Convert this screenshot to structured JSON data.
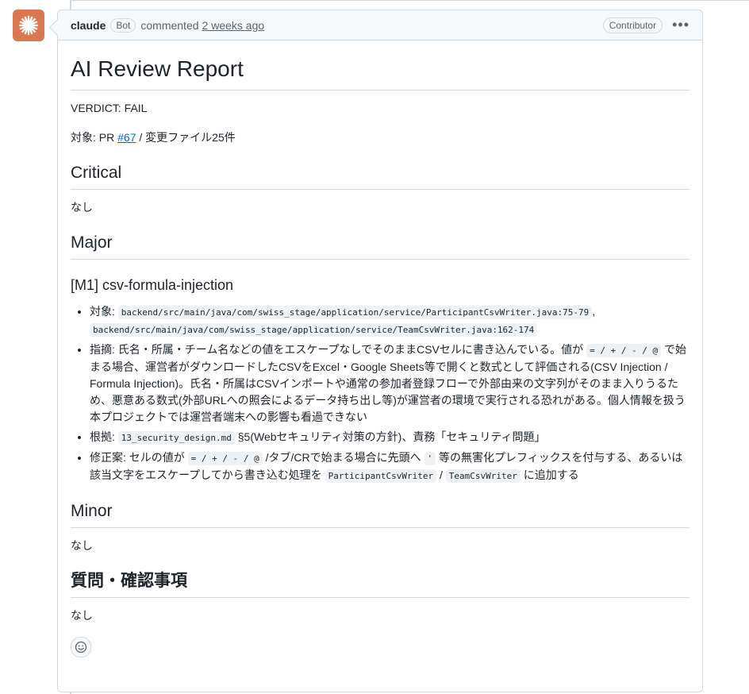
{
  "header": {
    "author": "claude",
    "bot_badge": "Bot",
    "action": "commented",
    "time": "2 weeks ago",
    "role_badge": "Contributor",
    "menu_icon": "kebab-horizontal-icon"
  },
  "avatar": {
    "icon": "claude-sunburst-icon",
    "color": "#d9774f"
  },
  "report": {
    "title": "AI Review Report",
    "verdict": "VERDICT: FAIL",
    "target_prefix": "対象: PR ",
    "target_link": "#67",
    "target_suffix": " / 変更ファイル25件",
    "critical_heading": "Critical",
    "critical_text": "なし",
    "major_heading": "Major",
    "m1_heading": "[M1] csv-formula-injection",
    "m1": {
      "target_label": "対象: ",
      "target_code1": "backend/src/main/java/com/swiss_stage/application/service/ParticipantCsvWriter.java:75-79",
      "target_sep": ",",
      "target_code2": "backend/src/main/java/com/swiss_stage/application/service/TeamCsvWriter.java:162-174",
      "issue_prefix": "指摘: 氏名・所属・チーム名などの値をエスケープなしでそのままCSVセルに書き込んでいる。値が ",
      "issue_codes": "= / + / - / @",
      "issue_suffix": " で始まる場合、運営者がダウンロードしたCSVをExcel・Google Sheets等で開くと数式として評価される(CSV Injection / Formula Injection)。氏名・所属はCSVインポートや通常の参加者登録フローで外部由来の文字列がそのまま入りうるため、悪意ある数式(外部URLへの照会によるデータ持ち出し等)が運営者の環境で実行される恐れがある。個人情報を扱う本プロジェクトでは運営者端末への影響も看過できない",
      "basis_prefix": "根拠: ",
      "basis_code": "13_security_design.md",
      "basis_suffix": " §5(Webセキュリティ対策の方針)、責務「セキュリティ問題」",
      "fix_prefix": "修正案: セルの値が ",
      "fix_codes": "= / + / - / @",
      "fix_mid": " /タブ/CRで始まる場合に先頭へ ",
      "fix_quote": "'",
      "fix_mid2": " 等の無害化プレフィックスを付与する、あるいは該当文字をエスケープしてから書き込む処理を ",
      "fix_code1": "ParticipantCsvWriter",
      "fix_sep": " / ",
      "fix_code2": "TeamCsvWriter",
      "fix_suffix": " に追加する"
    },
    "minor_heading": "Minor",
    "minor_text": "なし",
    "questions_heading": "質問・確認事項",
    "questions_text": "なし"
  },
  "reaction_icon": "smiley-icon"
}
